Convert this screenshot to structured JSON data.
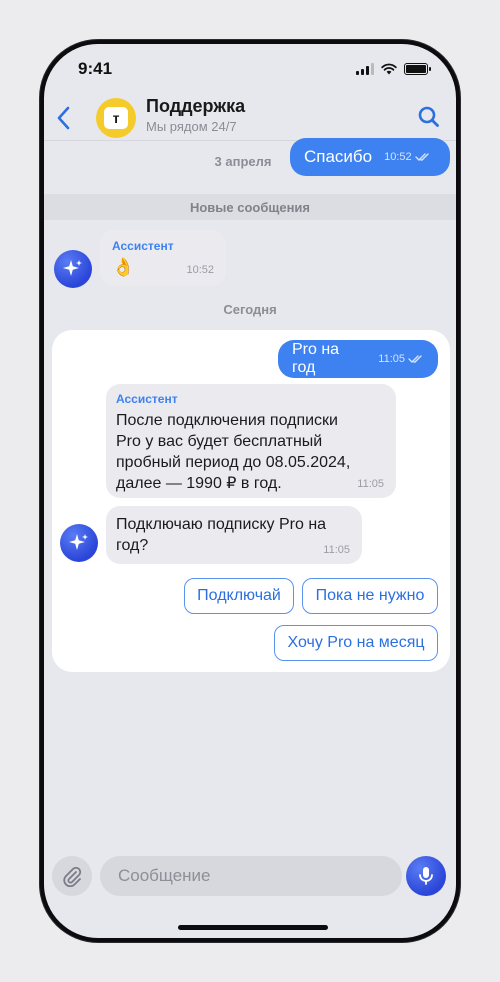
{
  "status_bar": {
    "time": "9:41"
  },
  "header": {
    "title": "Поддержка",
    "subtitle": "Мы рядом 24/7",
    "logo_letter": "т"
  },
  "messages": {
    "m1": {
      "text": "Спасибо",
      "time": "10:52"
    },
    "new_messages_label": "Новые сообщения",
    "m2": {
      "sender": "Ассистент",
      "text": "👌",
      "time": "10:52"
    },
    "date_earlier": "3 апреля",
    "date_today": "Сегодня",
    "m3": {
      "text": "Pro на год",
      "time": "11:05"
    },
    "m4": {
      "sender": "Ассистент",
      "lines": [
        "После подключения подписки",
        "Pro у вас будет бесплатный",
        "пробный период до 08.05.2024,",
        "далее — 1990 ₽ в год."
      ],
      "time": "11:05"
    },
    "m5": {
      "lines": [
        "Подключаю подписку Pro на",
        "год?"
      ],
      "time": "11:05"
    }
  },
  "quick_replies": {
    "r1": "Подключай",
    "r2": "Пока не нужно",
    "r3": "Хочу Pro на месяц"
  },
  "composer": {
    "placeholder": "Сообщение"
  },
  "colors": {
    "accent": "#3d82f0",
    "logo": "#f5cb2b",
    "bot": "#2a45d8"
  }
}
